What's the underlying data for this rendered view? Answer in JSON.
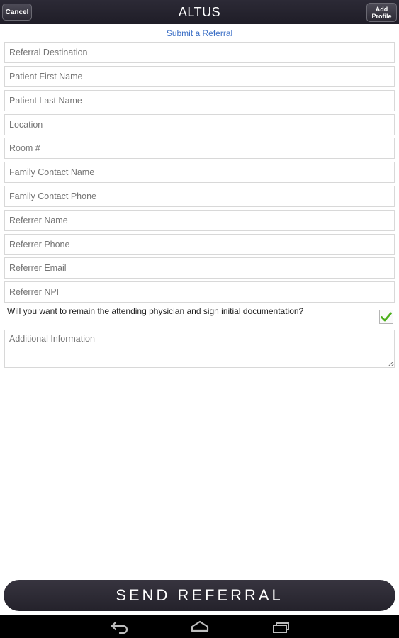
{
  "header": {
    "cancel_label": "Cancel",
    "title": "ALTUS",
    "add_profile_line1": "Add",
    "add_profile_line2": "Profile"
  },
  "form": {
    "heading": "Submit a Referral",
    "fields": [
      {
        "placeholder": "Referral Destination",
        "value": ""
      },
      {
        "placeholder": "Patient First Name",
        "value": ""
      },
      {
        "placeholder": "Patient Last Name",
        "value": ""
      },
      {
        "placeholder": "Location",
        "value": ""
      },
      {
        "placeholder": "Room #",
        "value": ""
      },
      {
        "placeholder": "Family Contact Name",
        "value": ""
      },
      {
        "placeholder": "Family Contact Phone",
        "value": ""
      },
      {
        "placeholder": "Referrer Name",
        "value": ""
      },
      {
        "placeholder": "Referrer Phone",
        "value": ""
      },
      {
        "placeholder": "Referrer Email",
        "value": ""
      },
      {
        "placeholder": "Referrer NPI",
        "value": ""
      }
    ],
    "attending_question": "Will you want to remain the attending physician and sign initial documentation?",
    "attending_checked": true,
    "additional_info_placeholder": "Additional Information",
    "send_label": "SEND REFERRAL"
  },
  "colors": {
    "bar_bg": "#24222b",
    "link_blue": "#3b6fc6",
    "check_green": "#4caf1a"
  },
  "navbar": {
    "icons": [
      "back-icon",
      "home-icon",
      "recent-apps-icon"
    ]
  }
}
